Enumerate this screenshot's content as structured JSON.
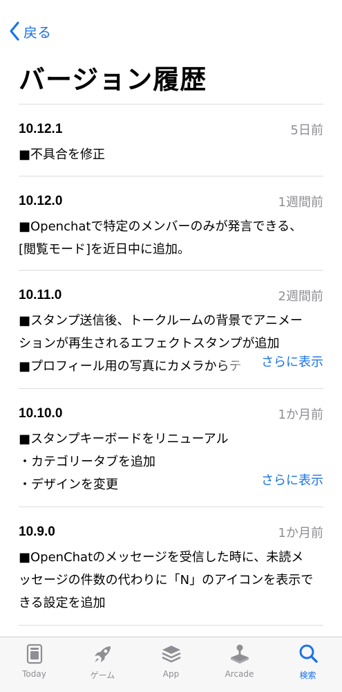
{
  "nav": {
    "back_label": "戻る"
  },
  "page_title": "バージョン履歴",
  "entries": [
    {
      "version": "10.12.1",
      "date": "5日前",
      "lines": [
        "■不具合を修正"
      ],
      "more": ""
    },
    {
      "version": "10.12.0",
      "date": "1週間前",
      "lines": [
        "■Openchatで特定のメンバーのみが発言できる、",
        "[閲覧モード]を近日中に追加。"
      ],
      "more": ""
    },
    {
      "version": "10.11.0",
      "date": "2週間前",
      "lines": [
        "■スタンプ送信後、トークルームの背景でアニメー",
        "ションが再生されるエフェクトスタンプが追加",
        "■プロフィール用の写真にカメラからテ"
      ],
      "more": "さらに表示"
    },
    {
      "version": "10.10.0",
      "date": "1か月前",
      "lines": [
        "■スタンプキーボードをリニューアル",
        "・カテゴリータブを追加",
        "・デザインを変更"
      ],
      "more": "さらに表示"
    },
    {
      "version": "10.9.0",
      "date": "1か月前",
      "lines": [
        "■OpenChatのメッセージを受信した時に、未読メ",
        "ッセージの件数の代わりに「N」のアイコンを表示で",
        "きる設定を追加"
      ],
      "more": ""
    }
  ],
  "tabbar": {
    "tabs": [
      {
        "label": "Today",
        "icon": "today-icon",
        "active": false
      },
      {
        "label": "ゲーム",
        "icon": "rocket-icon",
        "active": false
      },
      {
        "label": "App",
        "icon": "layers-icon",
        "active": false
      },
      {
        "label": "Arcade",
        "icon": "joystick-icon",
        "active": false
      },
      {
        "label": "検索",
        "icon": "search-icon",
        "active": true
      }
    ]
  },
  "colors": {
    "accent": "#1a73e8",
    "secondary_text": "#8e8e93",
    "divider": "#dcdcdc",
    "tab_inactive": "#8e8e93"
  }
}
